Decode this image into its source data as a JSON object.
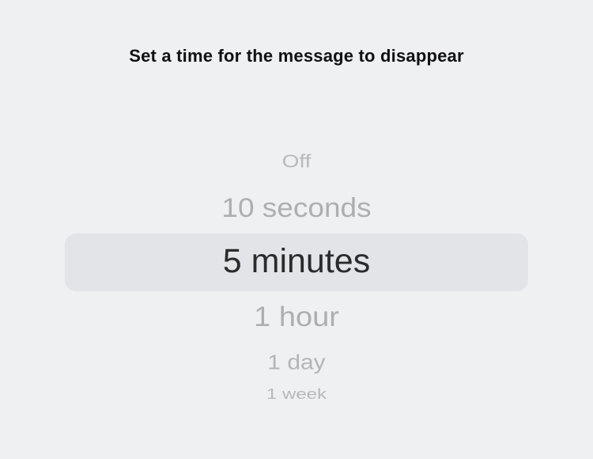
{
  "dialog": {
    "title": "Set a time for the message to disappear"
  },
  "picker": {
    "selected": "5 minutes",
    "options": [
      {
        "label": "Off"
      },
      {
        "label": "10 seconds"
      },
      {
        "label": "5 minutes"
      },
      {
        "label": "1 hour"
      },
      {
        "label": "1 day"
      },
      {
        "label": "1 week"
      }
    ]
  },
  "colors": {
    "background": "#eff0f2",
    "selection_band": "#e3e4e7",
    "selected_text": "#2b2b2d",
    "unselected_text": "#adaeb1"
  }
}
